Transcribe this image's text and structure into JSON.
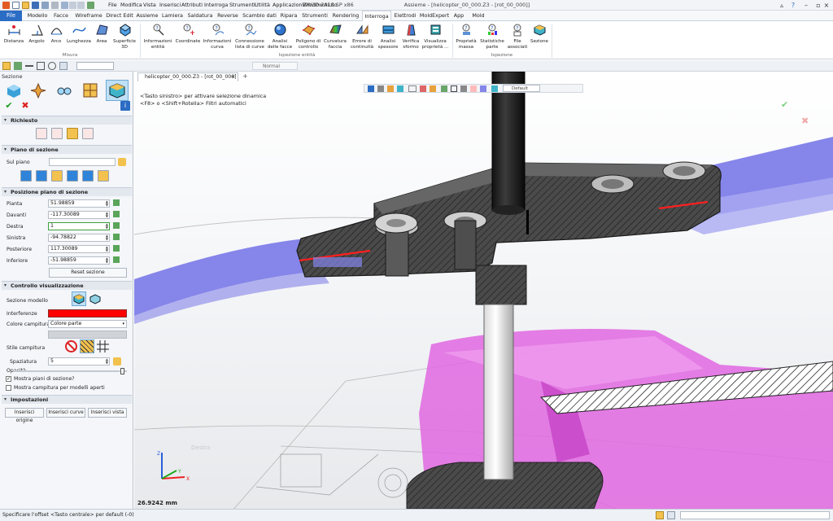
{
  "app": {
    "title": "ZW3D 2015 SP x86",
    "document_title": "Assieme - [helicopter_00_000.Z3 - [rot_00_000]]"
  },
  "menu": [
    "File",
    "Modifica",
    "Vista",
    "Inserisci",
    "Attributi",
    "Interroga",
    "Strumenti",
    "Utilità",
    "Applicazioni",
    "Window",
    "Aiuto"
  ],
  "ribbon_tabs": [
    "File",
    "Modello",
    "Facce",
    "Wireframe",
    "Direct Edit",
    "Assieme",
    "Lamiera",
    "Saldatura",
    "Reverse",
    "Scambio dati",
    "Ripara",
    "Strumenti",
    "Rendering",
    "Interroga",
    "Elettrodi",
    "MoldExpert",
    "App",
    "Mold"
  ],
  "ribbon_active": "Interroga",
  "ribbon_groups": {
    "misura": {
      "label": "Misura",
      "buttons": [
        "Distanza",
        "Angolo",
        "Arco",
        "Lunghezza",
        "Area",
        "Superficie 3D"
      ]
    },
    "ispezione_entita": {
      "label": "Ispezione entità",
      "buttons": [
        "Informazioni entità",
        "Coordinate",
        "Informazioni curva",
        "Connessione lista di curve",
        "Analisi delle facce",
        "Poligono di controllo",
        "Curvatura faccia",
        "Errore di continuità",
        "Analisi spessore",
        "Verifica sformo",
        "Visualizza proprietà ..."
      ]
    },
    "ispezione": {
      "label": "Ispezione",
      "buttons": [
        "Proprietà massa",
        "Statistiche parte",
        "File associati",
        "Sezione"
      ]
    }
  },
  "ribbon_dropdown_marks": [
    "▾",
    "▾"
  ],
  "left_panel": {
    "title": "Sezione",
    "sections": {
      "richiesto": "Richiesto",
      "piano": "Piano di sezione",
      "posizione": "Posizione piano di sezione",
      "controllo": "Controllo visualizzazione",
      "impostazioni": "Impostazioni"
    },
    "sul_piano_label": "Sul piano",
    "fields": [
      {
        "label": "Pianta",
        "value": "51.98859"
      },
      {
        "label": "Davanti",
        "value": "-117.30089"
      },
      {
        "label": "Destra",
        "value": "1"
      },
      {
        "label": "Sinistra",
        "value": "-94.78822"
      },
      {
        "label": "Posteriore",
        "value": "117.30089"
      },
      {
        "label": "Inferiore",
        "value": "-51.98859"
      }
    ],
    "reset_button": "Reset sezione",
    "sezione_modello_label": "Sezione modello",
    "interferenze_label": "Interferenze",
    "interferenze_color": "#ff0000",
    "colore_campitura_label": "Colore campitura",
    "colore_campitura_value": "Colore parte",
    "stile_campitura_label": "Stile campitura",
    "spaziatura_label": "Spaziatura",
    "spaziatura_value": "5",
    "opacita_label": "Opacità",
    "opacita_value": 0.98,
    "check1": "Mostra piani di sezione?",
    "check2": "Mostra campitura per modelli aperti",
    "buttons": [
      "Inserisci origine",
      "Inserisci curve",
      "Inserisci vista"
    ]
  },
  "toolbar": {
    "normal_label": "Normal",
    "default_label": "Default",
    "plus": "+"
  },
  "doc_tab": {
    "label": "helicopter_00_000.Z3 - [rot_00_000]",
    "close": "×"
  },
  "viewport": {
    "hint1": "<Tasto sinistro> per attivare selezione dinamica",
    "hint2": "<F8> o <Shift+Rotella> Filtri automatici",
    "scale": "26.9242 mm",
    "watermark": "Destra",
    "axes": {
      "x": "X",
      "y": "Y",
      "z": "Z"
    }
  },
  "status": {
    "text": "Specificare l'offset <Tasto centrale> per default (-0)"
  },
  "colors": {
    "accent": "#2b6cc4",
    "purple": "#8585ea",
    "magenta": "#e05fe0",
    "hatch": "#555555"
  }
}
